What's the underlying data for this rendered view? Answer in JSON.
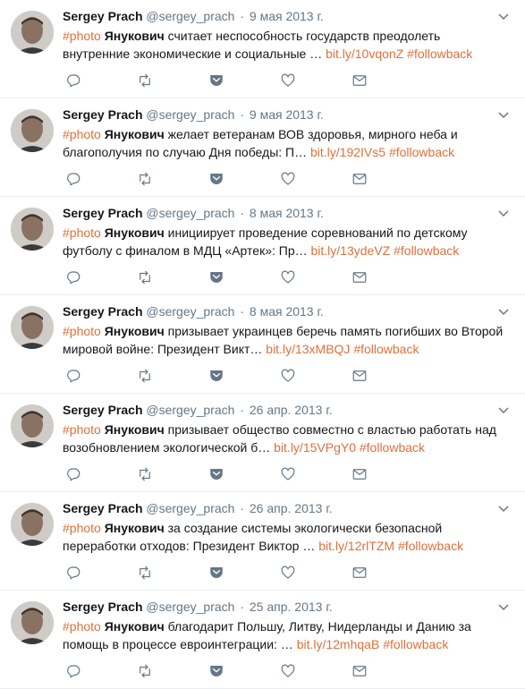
{
  "tweets": [
    {
      "name": "Sergey Prach",
      "handle": "@sergey_prach",
      "separator": "·",
      "date": "9 мая 2013 г.",
      "hashtag": "#photo",
      "keyword": "Янукович",
      "text": " считает неспособность государств преодолеть внутренние экономические и социальные … ",
      "link": "bit.ly/10vqonZ",
      "tag2": "#followback"
    },
    {
      "name": "Sergey Prach",
      "handle": "@sergey_prach",
      "separator": "·",
      "date": "9 мая 2013 г.",
      "hashtag": "#photo",
      "keyword": "Янукович",
      "text": " желает ветеранам ВОВ здоровья, мирного неба и благополучия по случаю Дня победы: П… ",
      "link": "bit.ly/192IVs5",
      "tag2": "#followback"
    },
    {
      "name": "Sergey Prach",
      "handle": "@sergey_prach",
      "separator": "·",
      "date": "8 мая 2013 г.",
      "hashtag": "#photo",
      "keyword": "Янукович",
      "text": " инициирует проведение соревнований по детскому футболу с финалом в МДЦ «Артек»: Пр… ",
      "link": "bit.ly/13ydeVZ",
      "tag2": "#followback"
    },
    {
      "name": "Sergey Prach",
      "handle": "@sergey_prach",
      "separator": "·",
      "date": "8 мая 2013 г.",
      "hashtag": "#photo",
      "keyword": "Янукович",
      "text": " призывает украинцев беречь память погибших во Второй мировой войне: Президент Викт… ",
      "link": "bit.ly/13xMBQJ",
      "tag2": "#followback"
    },
    {
      "name": "Sergey Prach",
      "handle": "@sergey_prach",
      "separator": "·",
      "date": "26 апр. 2013 г.",
      "hashtag": "#photo",
      "keyword": "Янукович",
      "text": " призывает общество совместно с властью работать над возобновлением экологической б… ",
      "link": "bit.ly/15VPgY0",
      "tag2": "#followback"
    },
    {
      "name": "Sergey Prach",
      "handle": "@sergey_prach",
      "separator": "·",
      "date": "26 апр. 2013 г.",
      "hashtag": "#photo",
      "keyword": "Янукович",
      "text": " за создание системы экологически безопасной переработки отходов: Президент Виктор … ",
      "link": "bit.ly/12rlTZM",
      "tag2": "#followback"
    },
    {
      "name": "Sergey Prach",
      "handle": "@sergey_prach",
      "separator": "·",
      "date": "25 апр. 2013 г.",
      "hashtag": "#photo",
      "keyword": "Янукович",
      "text": " благодарит Польшу, Литву, Нидерланды и Данию за помощь в процессе евроинтеграции: … ",
      "link": "bit.ly/12mhqaB",
      "tag2": "#followback"
    }
  ],
  "icons": {
    "reply": "reply-icon",
    "retweet": "retweet-icon",
    "pocket": "pocket-icon",
    "like": "heart-icon",
    "dm": "envelope-icon",
    "caret": "chevron-down-icon"
  },
  "colors": {
    "accent": "#e0703a",
    "muted": "#657786",
    "text": "#14171a",
    "divider": "#e6ecf0"
  }
}
